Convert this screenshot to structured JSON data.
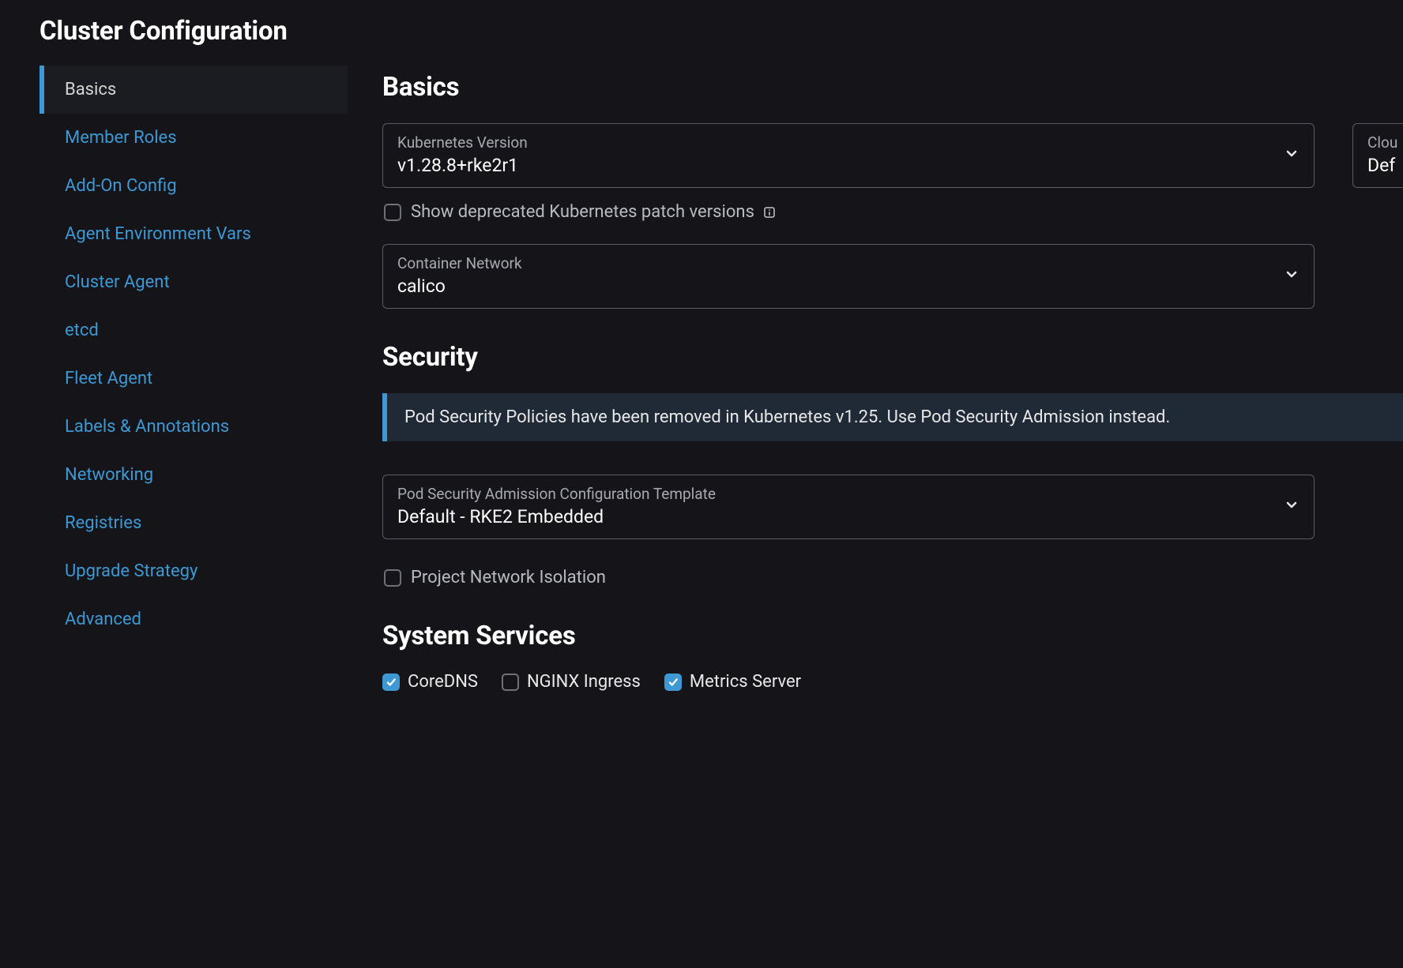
{
  "page_title": "Cluster Configuration",
  "sidebar": {
    "items": [
      {
        "label": "Basics",
        "active": true
      },
      {
        "label": "Member Roles",
        "active": false
      },
      {
        "label": "Add-On Config",
        "active": false
      },
      {
        "label": "Agent Environment Vars",
        "active": false
      },
      {
        "label": "Cluster Agent",
        "active": false
      },
      {
        "label": "etcd",
        "active": false
      },
      {
        "label": "Fleet Agent",
        "active": false
      },
      {
        "label": "Labels & Annotations",
        "active": false
      },
      {
        "label": "Networking",
        "active": false
      },
      {
        "label": "Registries",
        "active": false
      },
      {
        "label": "Upgrade Strategy",
        "active": false
      },
      {
        "label": "Advanced",
        "active": false
      }
    ]
  },
  "basics": {
    "heading": "Basics",
    "k8s_version": {
      "label": "Kubernetes Version",
      "value": "v1.28.8+rke2r1"
    },
    "cloud_provider": {
      "label": "Clou",
      "value": "Def"
    },
    "show_deprecated": {
      "label": "Show deprecated Kubernetes patch versions",
      "checked": false
    },
    "container_network": {
      "label": "Container Network",
      "value": "calico"
    }
  },
  "security": {
    "heading": "Security",
    "banner": "Pod Security Policies have been removed in Kubernetes v1.25. Use Pod Security Admission instead.",
    "psa_template": {
      "label": "Pod Security Admission Configuration Template",
      "value": "Default - RKE2 Embedded"
    },
    "project_network_isolation": {
      "label": "Project Network Isolation",
      "checked": false
    }
  },
  "system_services": {
    "heading": "System Services",
    "options": [
      {
        "label": "CoreDNS",
        "checked": true
      },
      {
        "label": "NGINX Ingress",
        "checked": false
      },
      {
        "label": "Metrics Server",
        "checked": true
      }
    ]
  }
}
